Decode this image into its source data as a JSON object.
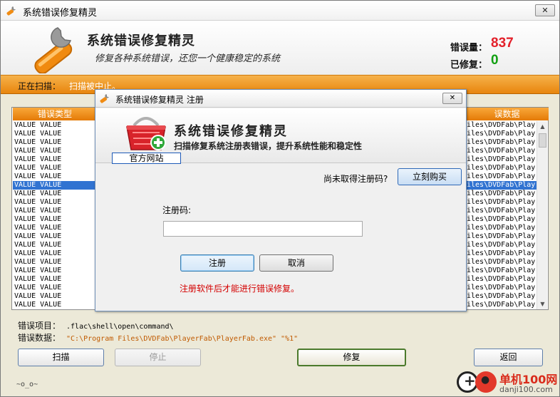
{
  "window": {
    "title": "系统错误修复精灵",
    "close_label": "✕"
  },
  "header": {
    "app_title": "系统错误修复精灵",
    "subtitle": "修复各种系统错误，还您一个健康稳定的系统",
    "errors_label": "错误量：",
    "errors_value": "837",
    "fixed_label": "已修复：",
    "fixed_value": "0",
    "colors": {
      "errors": "#e3202a",
      "fixed": "#12a012",
      "accent": "#f08c14"
    }
  },
  "scan": {
    "label": "正在扫描：",
    "value": "扫描被中止。"
  },
  "list": {
    "col_type": "错误类型",
    "col_data": "误数据",
    "rows_left": [
      "VALUE  VALUE",
      "VALUE  VALUE",
      "VALUE  VALUE",
      "VALUE  VALUE",
      "VALUE  VALUE",
      "VALUE  VALUE",
      "VALUE  VALUE",
      "VALUE  VALUE",
      "VALUE  VALUE",
      "VALUE  VALUE",
      "VALUE  VALUE",
      "VALUE  VALUE",
      "VALUE  VALUE",
      "VALUE  VALUE",
      "VALUE  VALUE",
      "VALUE  VALUE",
      "VALUE  VALUE",
      "VALUE  VALUE",
      "VALUE  VALUE",
      "VALUE  VALUE",
      "VALUE  VALUE",
      "VALUE  VALUE"
    ],
    "rows_right": [
      "iles\\DVDFab\\Play",
      "iles\\DVDFab\\Play",
      "iles\\DVDFab\\Play",
      "iles\\DVDFab\\Play",
      "iles\\DVDFab\\Play",
      "iles\\DVDFab\\Play",
      "iles\\DVDFab\\Play",
      "iles\\DVDFab\\Play",
      "iles\\DVDFab\\Play",
      "iles\\DVDFab\\Play",
      "iles\\DVDFab\\Play",
      "iles\\DVDFab\\Play",
      "iles\\DVDFab\\Play",
      "iles\\DVDFab\\Play",
      "iles\\DVDFab\\Play",
      "iles\\DVDFab\\Play",
      "iles\\DVDFab\\Play",
      "iles\\DVDFab\\Play",
      "iles\\DVDFab\\Play",
      "iles\\DVDFab\\Play",
      "iles\\DVDFab\\Play",
      "iles\\DVDFab\\Play"
    ],
    "selected_index": 7
  },
  "details": {
    "item_label": "错误项目：",
    "item_value": ".flac\\shell\\open\\command\\",
    "data_label": "错误数据：",
    "data_value": "\"C:\\Program Files\\DVDFab\\PlayerFab\\PlayerFab.exe\" \"%1\""
  },
  "buttons": {
    "scan": "扫描",
    "stop": "停止",
    "repair": "修复",
    "back": "返回"
  },
  "footer": {
    "emote": "~o_o~"
  },
  "watermark": {
    "brand": "单机100网",
    "domain": "danji100.com"
  },
  "dialog": {
    "title": "系统错误修复精灵 注册",
    "close_label": "✕",
    "heading": "系统错误修复精灵",
    "subheading": "扫描修复系统注册表错误，提升系统性能和稳定性",
    "official_site": "官方网站",
    "no_code_question": "尚未取得注册码?",
    "buy_now": "立刻购买",
    "code_label": "注册码:",
    "code_value": "",
    "register": "注册",
    "cancel": "取消",
    "warning": "注册软件后才能进行错误修复。"
  }
}
